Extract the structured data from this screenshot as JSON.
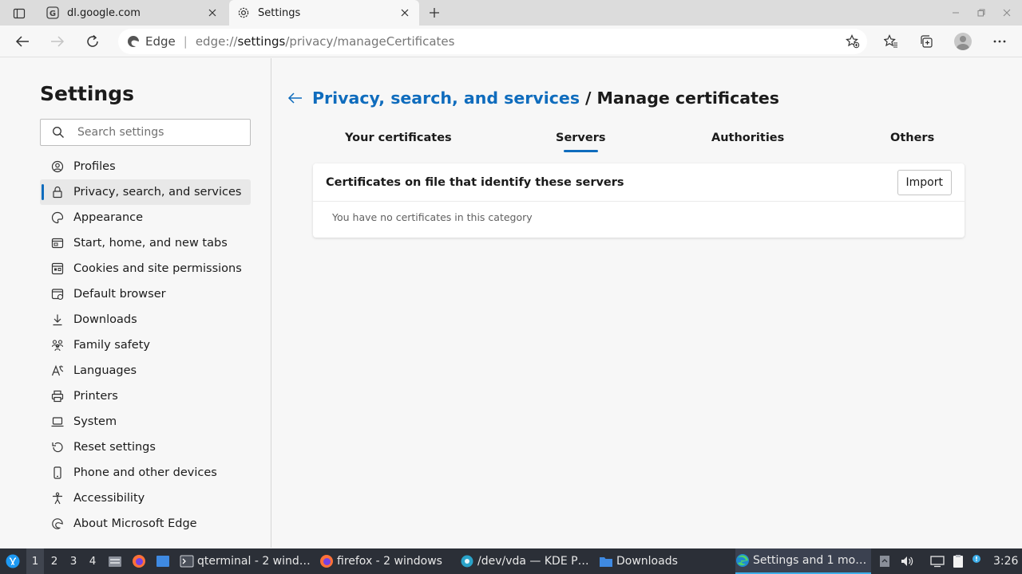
{
  "browser": {
    "tabs": [
      {
        "title": "dl.google.com",
        "icon": "google-icon"
      },
      {
        "title": "Settings",
        "icon": "gear-icon"
      }
    ],
    "address": {
      "brand": "Edge",
      "scheme": "edge://",
      "host": "settings",
      "path": "/privacy/manageCertificates"
    }
  },
  "sidebar": {
    "title": "Settings",
    "search_placeholder": "Search settings",
    "items": [
      {
        "label": "Profiles",
        "icon": "profile-icon"
      },
      {
        "label": "Privacy, search, and services",
        "icon": "lock-icon",
        "selected": true
      },
      {
        "label": "Appearance",
        "icon": "appearance-icon"
      },
      {
        "label": "Start, home, and new tabs",
        "icon": "home-tabs-icon"
      },
      {
        "label": "Cookies and site permissions",
        "icon": "cookies-icon"
      },
      {
        "label": "Default browser",
        "icon": "browser-icon"
      },
      {
        "label": "Downloads",
        "icon": "download-icon"
      },
      {
        "label": "Family safety",
        "icon": "family-icon"
      },
      {
        "label": "Languages",
        "icon": "languages-icon"
      },
      {
        "label": "Printers",
        "icon": "printer-icon"
      },
      {
        "label": "System",
        "icon": "laptop-icon"
      },
      {
        "label": "Reset settings",
        "icon": "reset-icon"
      },
      {
        "label": "Phone and other devices",
        "icon": "phone-icon"
      },
      {
        "label": "Accessibility",
        "icon": "accessibility-icon"
      },
      {
        "label": "About Microsoft Edge",
        "icon": "edge-icon"
      }
    ]
  },
  "main": {
    "breadcrumb_link": "Privacy, search, and services",
    "breadcrumb_sep": "/",
    "page_title": "Manage certificates",
    "tabs": [
      {
        "label": "Your certificates"
      },
      {
        "label": "Servers",
        "active": true
      },
      {
        "label": "Authorities"
      },
      {
        "label": "Others"
      }
    ],
    "card": {
      "heading": "Certificates on file that identify these servers",
      "import_label": "Import",
      "empty_text": "You have no certificates in this category"
    }
  },
  "taskbar": {
    "workspaces": [
      "1",
      "2",
      "3",
      "4"
    ],
    "tasks": [
      {
        "label": "qterminal - 2 wind…",
        "icon": "terminal-icon"
      },
      {
        "label": "firefox - 2 windows",
        "icon": "firefox-icon"
      },
      {
        "label": "/dev/vda — KDE P…",
        "icon": "partition-manager-icon"
      },
      {
        "label": "Downloads",
        "icon": "folder-icon"
      },
      {
        "label": "Settings and 1 mo…",
        "icon": "edge-icon",
        "active": true
      }
    ],
    "clock": "3:26"
  },
  "colors": {
    "accent": "#0f6cbd",
    "taskbar": "#2b2f37"
  }
}
